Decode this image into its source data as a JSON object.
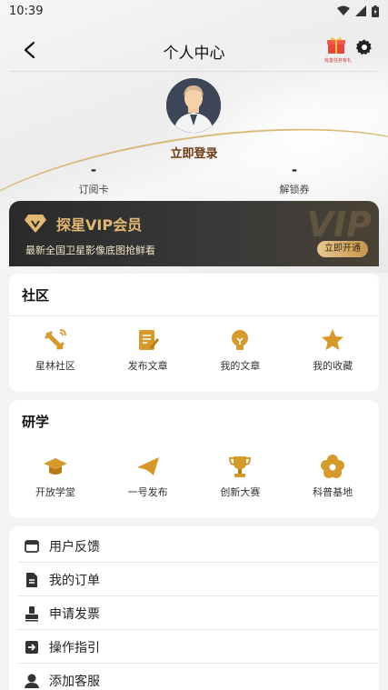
{
  "status_bar": {
    "time": "10:39"
  },
  "header": {
    "title": "个人中心",
    "gift_label": "完善任务有礼"
  },
  "profile": {
    "login_label": "立即登录"
  },
  "stats": [
    {
      "value": "-",
      "label": "订阅卡"
    },
    {
      "value": "-",
      "label": "解锁券"
    }
  ],
  "vip": {
    "title": "探星VIP会员",
    "subtitle": "最新全国卫星影像底图抢鲜看",
    "button": "立即开通",
    "watermark": "VIP"
  },
  "community": {
    "title": "社区",
    "items": [
      {
        "label": "星林社区",
        "icon": "satellite-icon"
      },
      {
        "label": "发布文章",
        "icon": "edit-doc-icon"
      },
      {
        "label": "我的文章",
        "icon": "bulb-icon"
      },
      {
        "label": "我的收藏",
        "icon": "star-icon"
      }
    ]
  },
  "study": {
    "title": "研学",
    "items": [
      {
        "label": "开放学堂",
        "icon": "graduation-cap-icon"
      },
      {
        "label": "一号发布",
        "icon": "paper-plane-icon"
      },
      {
        "label": "创新大赛",
        "icon": "trophy-icon"
      },
      {
        "label": "科普基地",
        "icon": "flower-icon"
      }
    ]
  },
  "menu": [
    {
      "label": "用户反馈",
      "icon": "feedback-icon"
    },
    {
      "label": "我的订单",
      "icon": "order-icon"
    },
    {
      "label": "申请发票",
      "icon": "invoice-icon"
    },
    {
      "label": "操作指引",
      "icon": "guide-icon"
    },
    {
      "label": "添加客服",
      "icon": "customer-service-icon"
    }
  ],
  "colors": {
    "gold": "#d59a2c",
    "vip_text": "#e3b972",
    "login": "#6b3a10"
  }
}
